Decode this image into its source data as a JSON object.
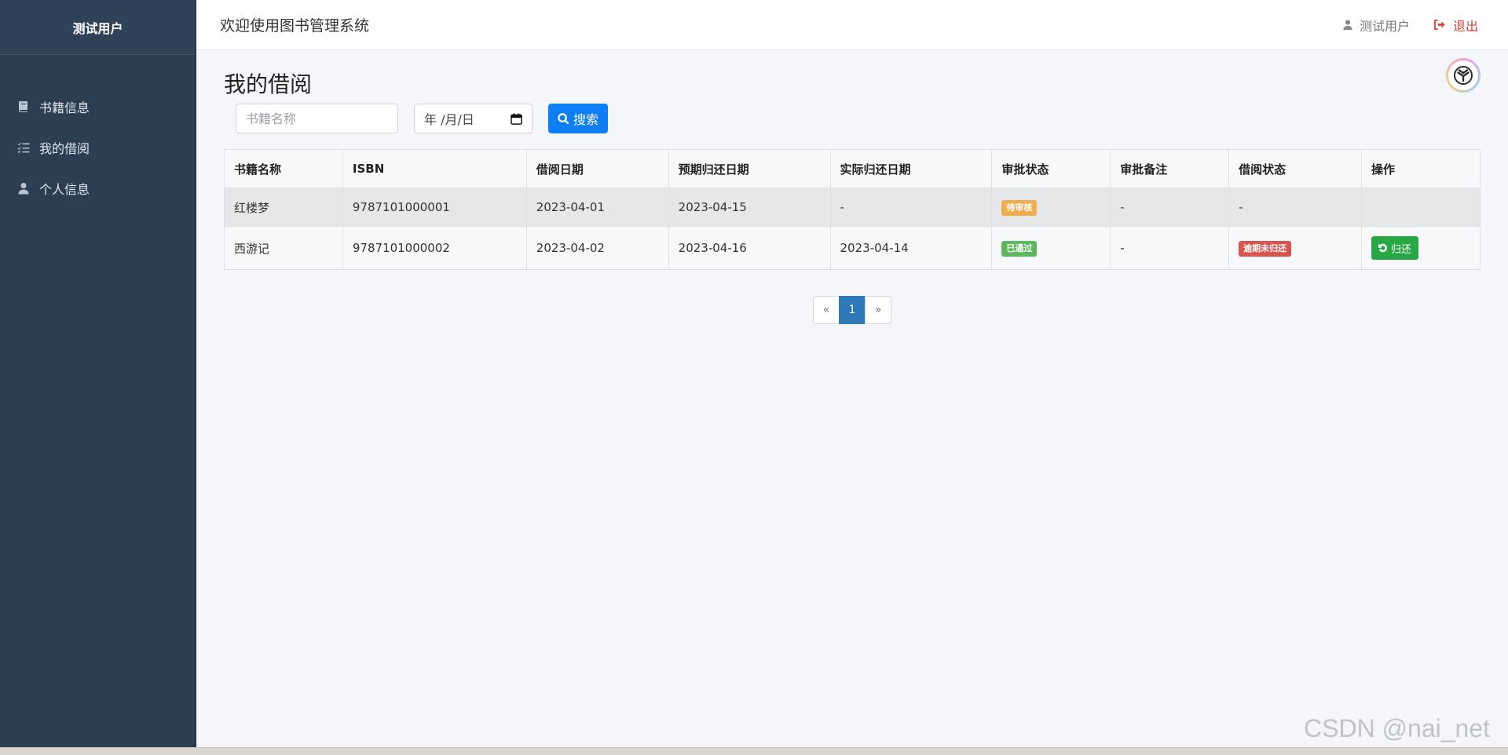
{
  "sidebar": {
    "brand": "测试用户",
    "items": [
      {
        "label": "书籍信息",
        "icon": "book-icon"
      },
      {
        "label": "我的借阅",
        "icon": "list-check-icon"
      },
      {
        "label": "个人信息",
        "icon": "user-icon"
      }
    ]
  },
  "header": {
    "title": "欢迎使用图书管理系统",
    "user_label": "测试用户",
    "logout_label": "退出"
  },
  "main": {
    "page_title": "我的借阅",
    "search": {
      "book_name_placeholder": "书籍名称",
      "book_name_value": "",
      "date_placeholder": "年 /月/日",
      "search_label": "搜索"
    },
    "table": {
      "columns": [
        "书籍名称",
        "ISBN",
        "借阅日期",
        "预期归还日期",
        "实际归还日期",
        "审批状态",
        "审批备注",
        "借阅状态",
        "操作"
      ],
      "rows": [
        {
          "name": "红楼梦",
          "isbn": "9787101000001",
          "borrow_date": "2023-04-01",
          "expected_return": "2023-04-15",
          "actual_return": "-",
          "approval_status": "待审核",
          "approval_note": "-",
          "borrow_status": "-",
          "action": ""
        },
        {
          "name": "西游记",
          "isbn": "9787101000002",
          "borrow_date": "2023-04-02",
          "expected_return": "2023-04-16",
          "actual_return": "2023-04-14",
          "approval_status": "已通过",
          "approval_note": "-",
          "borrow_status": "逾期未归还",
          "action": "归还"
        }
      ]
    },
    "pagination": {
      "prev": "«",
      "current": "1",
      "next": "»"
    }
  },
  "watermark": "CSDN @nai_net",
  "colors": {
    "sidebar_bg": "#2c3e52",
    "primary": "#0d7ef5",
    "warning": "#f0ad4e",
    "success": "#5cb85c",
    "danger": "#d9534f",
    "return_button": "#28a745",
    "logout": "#d6433b"
  }
}
